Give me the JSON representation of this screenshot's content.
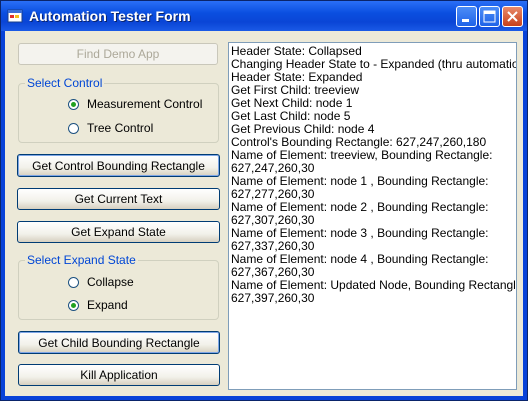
{
  "window": {
    "title": "Automation Tester Form"
  },
  "buttons": {
    "find_demo_app": "Find Demo App",
    "get_bounding_rect": "Get Control Bounding Rectangle",
    "get_current_text": "Get Current Text",
    "get_expand_state": "Get Expand State",
    "get_child_bounding_rect": "Get Child Bounding Rectangle",
    "kill_application": "Kill Application"
  },
  "select_control": {
    "label": "Select Control",
    "options": [
      "Measurement Control",
      "Tree Control"
    ],
    "selected": "Measurement Control"
  },
  "select_expand_state": {
    "label": "Select Expand State",
    "options": [
      "Collapse",
      "Expand"
    ],
    "selected": "Expand"
  },
  "output_lines": [
    "Header State: Collapsed",
    "Changing Header State to - Expanded (thru automation)",
    "Header State: Expanded",
    "Get First Child: treeview",
    "Get Next Child: node 1",
    "Get Last Child: node 5",
    "Get Previous Child: node 4",
    "Control's Bounding Rectangle: 627,247,260,180",
    "Name of Element: treeview, Bounding Rectangle:",
    "627,247,260,30",
    "Name of Element: node 1 , Bounding Rectangle:",
    "627,277,260,30",
    "Name of Element: node 2 , Bounding Rectangle:",
    "627,307,260,30",
    "Name of Element: node 3 , Bounding Rectangle:",
    "627,337,260,30",
    "Name of Element: node 4 , Bounding Rectangle:",
    "627,367,260,30",
    "Name of Element: Updated Node, Bounding Rectangle:",
    "627,397,260,30"
  ],
  "icons": {
    "app": "app-window-icon",
    "minimize": "minimize-icon",
    "maximize": "maximize-icon",
    "close": "close-icon"
  }
}
